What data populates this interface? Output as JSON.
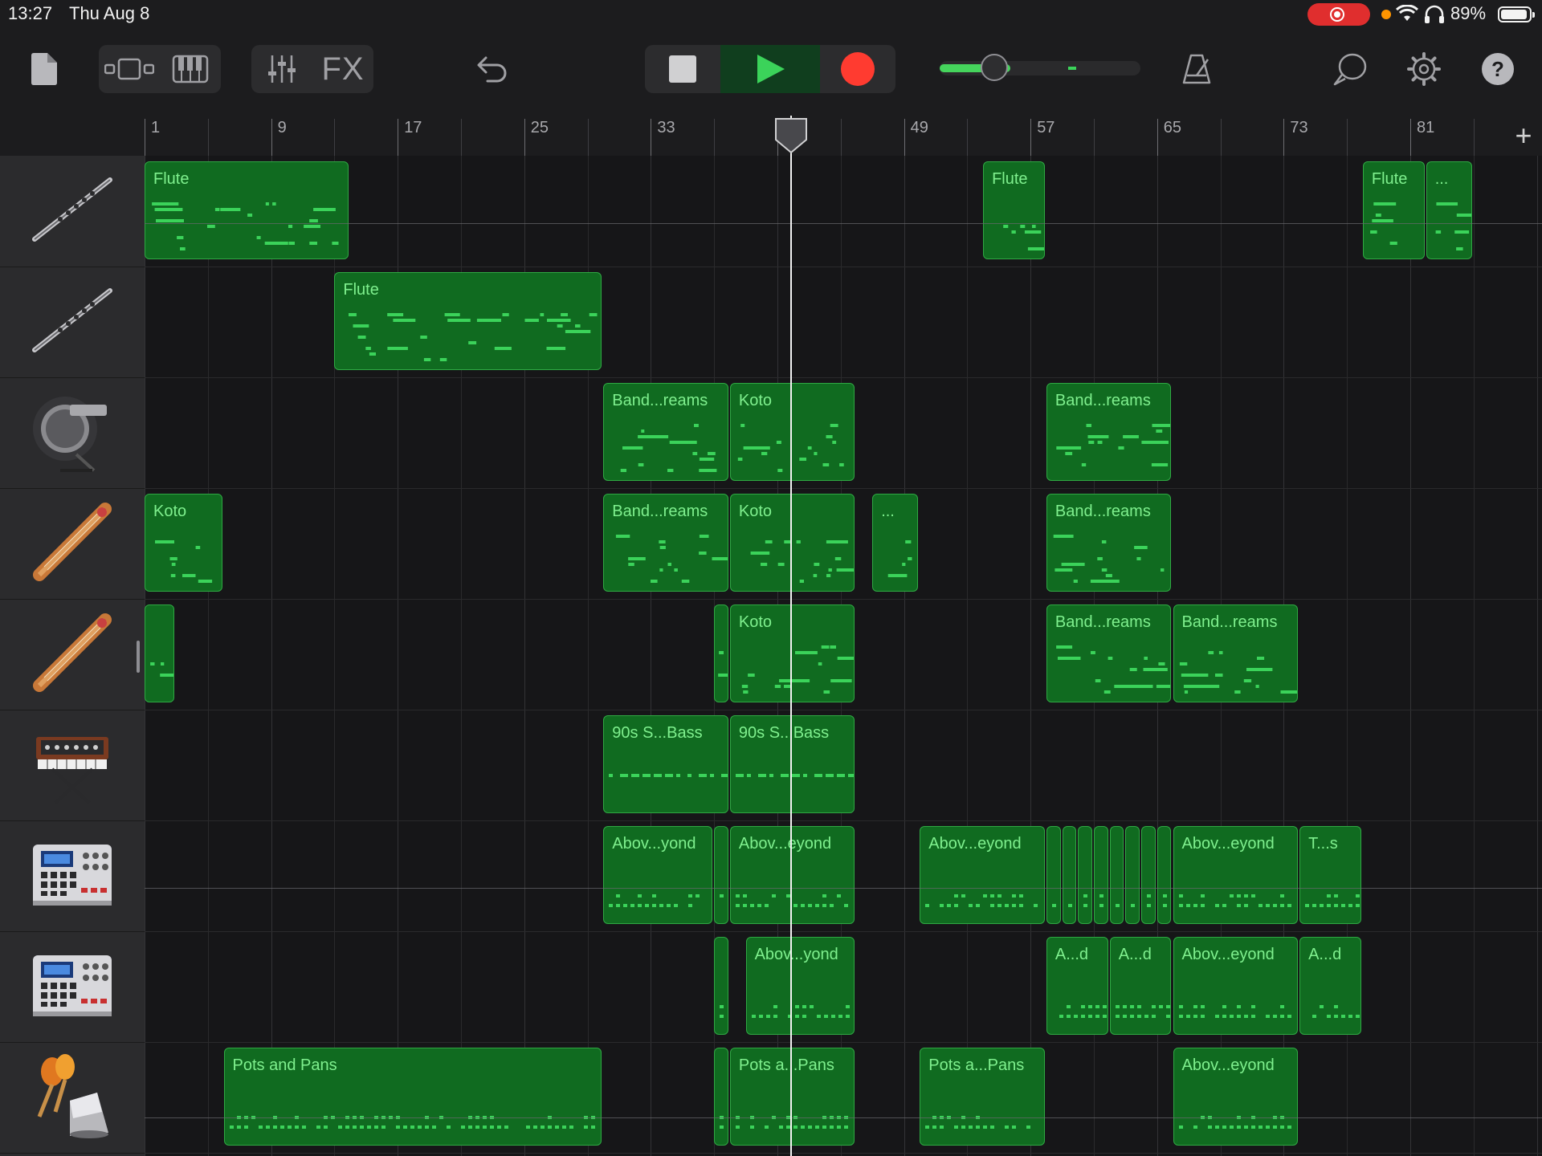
{
  "status_bar": {
    "time": "13:27",
    "date": "Thu Aug 8",
    "battery": "89%"
  },
  "toolbar": {
    "fx_label": "FX",
    "volume_level": 0.27,
    "colors": {
      "play": "#3bd35a",
      "record": "#ff3b30",
      "region_fill": "#106b20",
      "region_text": "#7ff08e"
    }
  },
  "ruler": {
    "bars": [
      "1",
      "9",
      "17",
      "25",
      "33",
      "41",
      "49",
      "57",
      "65",
      "73",
      "81"
    ],
    "add_label": "+"
  },
  "playhead_bar": 41,
  "tracks": [
    {
      "instrument": "flute-icon",
      "regions": [
        {
          "name": "Flute",
          "start": 1,
          "end": 14
        },
        {
          "name": "Flute",
          "start": 54,
          "end": 58
        },
        {
          "name": "Flute",
          "start": 78,
          "end": 82
        },
        {
          "name": "...",
          "start": 82,
          "end": 85
        }
      ]
    },
    {
      "instrument": "flute-icon",
      "regions": [
        {
          "name": "Flute",
          "start": 13,
          "end": 30
        }
      ]
    },
    {
      "instrument": "electronic-drum-kit-icon",
      "regions": [
        {
          "name": "Band...reams",
          "start": 30,
          "end": 38
        },
        {
          "name": "Koto",
          "start": 38,
          "end": 46
        },
        {
          "name": "Band...reams",
          "start": 58,
          "end": 66
        }
      ]
    },
    {
      "instrument": "koto-icon",
      "regions": [
        {
          "name": "Koto",
          "start": 1,
          "end": 6
        },
        {
          "name": "Band...reams",
          "start": 30,
          "end": 38
        },
        {
          "name": "Koto",
          "start": 38,
          "end": 46
        },
        {
          "name": "...",
          "start": 47,
          "end": 50
        },
        {
          "name": "Band...reams",
          "start": 58,
          "end": 66
        }
      ]
    },
    {
      "instrument": "koto-icon",
      "regions": [
        {
          "name": "",
          "start": 1,
          "end": 3
        },
        {
          "name": "",
          "start": 37,
          "end": 38
        },
        {
          "name": "Koto",
          "start": 38,
          "end": 46
        },
        {
          "name": "Band...reams",
          "start": 58,
          "end": 66
        },
        {
          "name": "Band...reams",
          "start": 66,
          "end": 74
        }
      ]
    },
    {
      "instrument": "synthesizer-icon",
      "regions": [
        {
          "name": "90s S...Bass",
          "start": 30,
          "end": 38
        },
        {
          "name": "90s S...Bass",
          "start": 38,
          "end": 46
        }
      ]
    },
    {
      "instrument": "beat-sequencer-icon",
      "regions": [
        {
          "name": "Abov...yond",
          "start": 30,
          "end": 37
        },
        {
          "name": "",
          "start": 37,
          "end": 38
        },
        {
          "name": "Abov...eyond",
          "start": 38,
          "end": 46
        },
        {
          "name": "Abov...eyond",
          "start": 50,
          "end": 58
        },
        {
          "name": "",
          "start": 58,
          "end": 59
        },
        {
          "name": "",
          "start": 59,
          "end": 60
        },
        {
          "name": "",
          "start": 60,
          "end": 61
        },
        {
          "name": "",
          "start": 61,
          "end": 62
        },
        {
          "name": "",
          "start": 62,
          "end": 63
        },
        {
          "name": "",
          "start": 63,
          "end": 64
        },
        {
          "name": "",
          "start": 64,
          "end": 65
        },
        {
          "name": "",
          "start": 65,
          "end": 66
        },
        {
          "name": "Abov...eyond",
          "start": 66,
          "end": 74
        },
        {
          "name": "T...s",
          "start": 74,
          "end": 78
        }
      ]
    },
    {
      "instrument": "beat-sequencer-icon",
      "regions": [
        {
          "name": "",
          "start": 37,
          "end": 38
        },
        {
          "name": "Abov...yond",
          "start": 39,
          "end": 46
        },
        {
          "name": "A...d",
          "start": 58,
          "end": 62
        },
        {
          "name": "A...d",
          "start": 62,
          "end": 66
        },
        {
          "name": "Abov...eyond",
          "start": 66,
          "end": 74
        },
        {
          "name": "A...d",
          "start": 74,
          "end": 78
        }
      ]
    },
    {
      "instrument": "percussion-icon",
      "regions": [
        {
          "name": "Pots and Pans",
          "start": 6,
          "end": 30
        },
        {
          "name": "",
          "start": 37,
          "end": 38
        },
        {
          "name": "Pots a...Pans",
          "start": 38,
          "end": 46
        },
        {
          "name": "Pots a...Pans",
          "start": 50,
          "end": 58
        },
        {
          "name": "Abov...eyond",
          "start": 66,
          "end": 74
        }
      ]
    }
  ]
}
